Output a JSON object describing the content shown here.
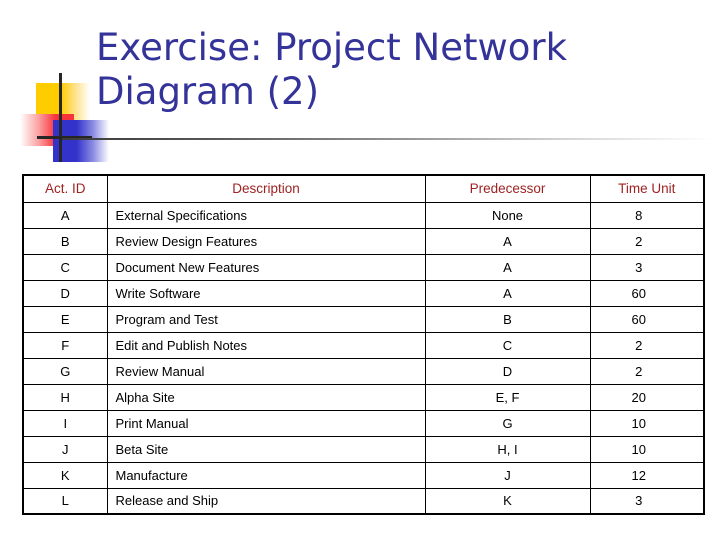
{
  "slide": {
    "title": "Exercise: Project Network Diagram (2)",
    "title_line1": "Exercise: Project Network",
    "title_line2": "Diagram (2)",
    "title_color": "#333399"
  },
  "logo": {
    "name": "decorative-corner-logo",
    "colors": {
      "yellow": "#ffcc00",
      "red": "#f8333c",
      "blue": "#3333cc",
      "line": "#262626"
    }
  },
  "rule": {
    "color_start": "#3b3b3b",
    "color_end": "#ffffff"
  },
  "table": {
    "header_color": "#9e2222",
    "columns": [
      "Act. ID",
      "Description",
      "Predecessor",
      "Time Unit"
    ],
    "rows": [
      {
        "id": "A",
        "description": "External Specifications",
        "predecessor": "None",
        "time_unit": "8"
      },
      {
        "id": "B",
        "description": "Review Design Features",
        "predecessor": "A",
        "time_unit": "2"
      },
      {
        "id": "C",
        "description": "Document New Features",
        "predecessor": "A",
        "time_unit": "3"
      },
      {
        "id": "D",
        "description": "Write Software",
        "predecessor": "A",
        "time_unit": "60"
      },
      {
        "id": "E",
        "description": "Program and Test",
        "predecessor": "B",
        "time_unit": "60"
      },
      {
        "id": "F",
        "description": "Edit and Publish Notes",
        "predecessor": "C",
        "time_unit": "2"
      },
      {
        "id": "G",
        "description": "Review Manual",
        "predecessor": "D",
        "time_unit": "2"
      },
      {
        "id": "H",
        "description": "Alpha Site",
        "predecessor": "E, F",
        "time_unit": "20"
      },
      {
        "id": "I",
        "description": "Print Manual",
        "predecessor": "G",
        "time_unit": "10"
      },
      {
        "id": "J",
        "description": "Beta Site",
        "predecessor": "H, I",
        "time_unit": "10"
      },
      {
        "id": "K",
        "description": "Manufacture",
        "predecessor": "J",
        "time_unit": "12"
      },
      {
        "id": "L",
        "description": "Release and Ship",
        "predecessor": "K",
        "time_unit": "3"
      }
    ]
  }
}
